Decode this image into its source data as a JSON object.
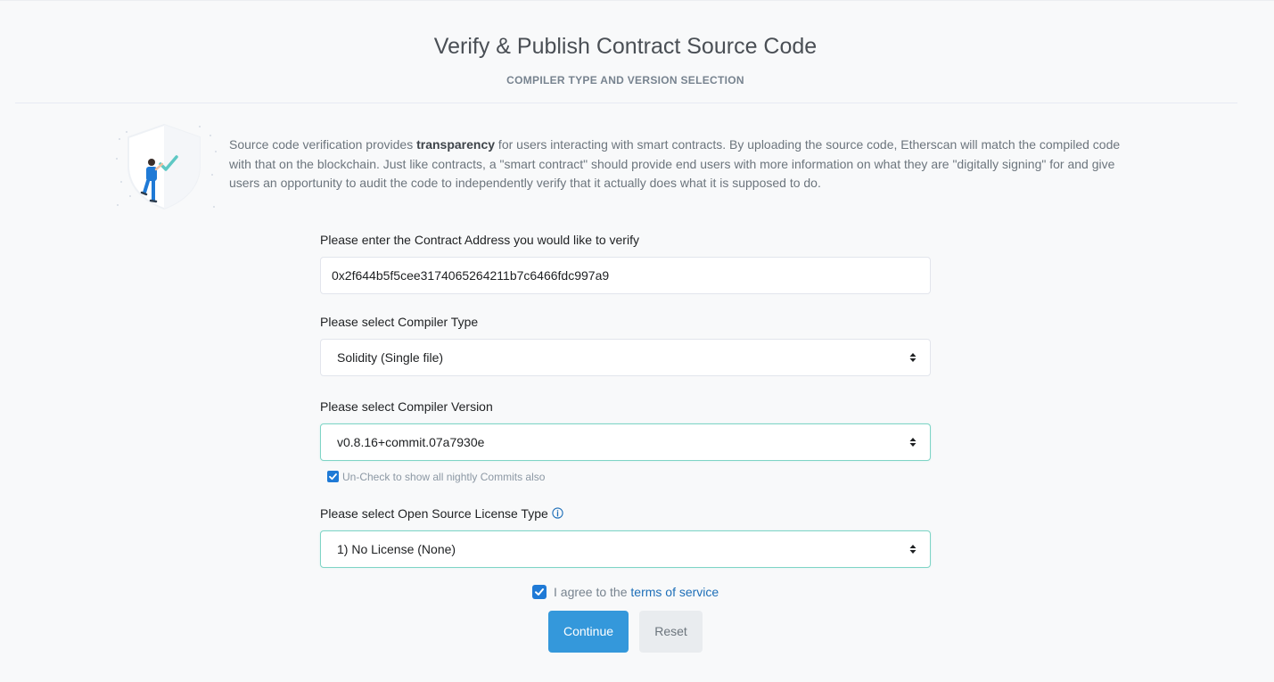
{
  "header": {
    "title": "Verify & Publish Contract Source Code",
    "subtitle": "COMPILER TYPE AND VERSION SELECTION"
  },
  "intro": {
    "text_before": "Source code verification provides ",
    "bold": "transparency",
    "text_after": " for users interacting with smart contracts. By uploading the source code, Etherscan will match the compiled code with that on the blockchain. Just like contracts, a \"smart contract\" should provide end users with more information on what they are \"digitally signing\" for and give users an opportunity to audit the code to independently verify that it actually does what it is supposed to do."
  },
  "form": {
    "address_label": "Please enter the Contract Address you would like to verify",
    "address_value": "0x2f644b5f5cee3174065264211b7c6466fdc997a9",
    "compiler_type_label": "Please select Compiler Type",
    "compiler_type_value": "Solidity (Single file)",
    "compiler_version_label": "Please select Compiler Version",
    "compiler_version_value": "v0.8.16+commit.07a7930e",
    "nightly_label": "Un-Check to show all nightly Commits also",
    "nightly_checked": true,
    "license_label": "Please select Open Source License Type",
    "license_value": "1) No License (None)",
    "agree_prefix": "I agree to the ",
    "agree_link": "terms of service",
    "agree_checked": true,
    "continue_label": "Continue",
    "reset_label": "Reset"
  },
  "colors": {
    "accent": "#3498db",
    "checkbox": "#1f7ad6",
    "link": "#1e6fb8",
    "focus_border": "#7fd4c6"
  },
  "icons": {
    "illustration": "shield-check-illustration",
    "info": "info-circle-icon",
    "select_arrows": "sort-arrows-icon",
    "checkbox": "checkmark-icon"
  }
}
